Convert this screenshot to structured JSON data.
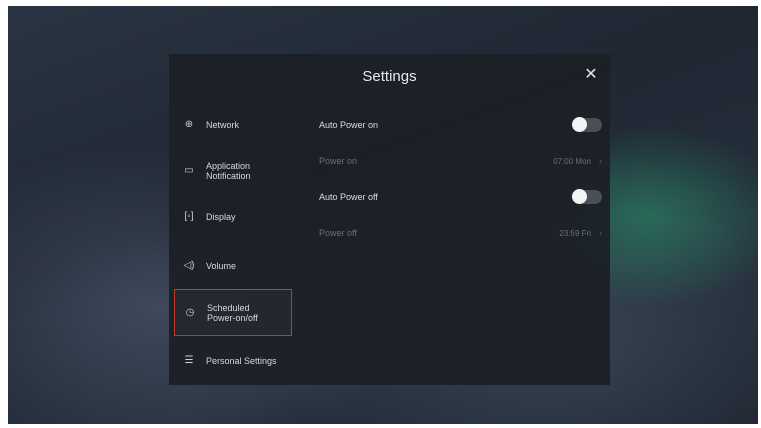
{
  "dialog": {
    "title": "Settings",
    "close_icon": "close-icon"
  },
  "sidebar": {
    "items": [
      {
        "label": "Network",
        "icon": "globe-icon"
      },
      {
        "label": "Application\nNotification",
        "icon": "notification-icon"
      },
      {
        "label": "Display",
        "icon": "display-icon"
      },
      {
        "label": "Volume",
        "icon": "volume-icon"
      },
      {
        "label": "Scheduled\nPower-on/off",
        "icon": "alarm-clock-icon",
        "selected": true
      },
      {
        "label": "Personal Settings",
        "icon": "menu-icon"
      }
    ]
  },
  "settings": {
    "auto_power_on": {
      "label": "Auto Power on",
      "enabled": false
    },
    "power_on": {
      "label": "Power on",
      "value": "07:00 Mon"
    },
    "auto_power_off": {
      "label": "Auto Power off",
      "enabled": false
    },
    "power_off": {
      "label": "Power off",
      "value": "23:59 Fri"
    }
  },
  "colors": {
    "selection_border": "#c0392b",
    "toggle_track": "#4a4f57",
    "toggle_knob": "#f2f3f4"
  }
}
